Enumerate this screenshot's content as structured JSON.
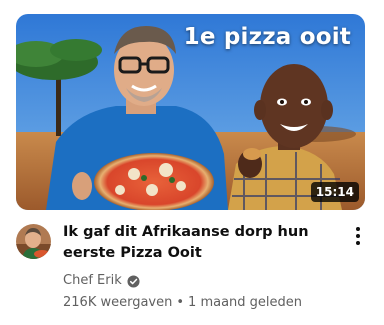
{
  "video": {
    "thumbnail_overlay_text": "1e pizza ooit",
    "duration": "15:14",
    "title": "Ik gaf dit Afrikaanse dorp hun eerste Pizza Ooit",
    "channel": "Chef Erik",
    "views": "216K weergaven",
    "separator": "•",
    "uploaded": "1 maand geleden"
  },
  "icons": {
    "verified": "verified-check-icon",
    "more": "more-vertical-icon"
  },
  "colors": {
    "title": "#0f0f0f",
    "secondary_text": "#606060",
    "duration_bg": "#000000"
  }
}
